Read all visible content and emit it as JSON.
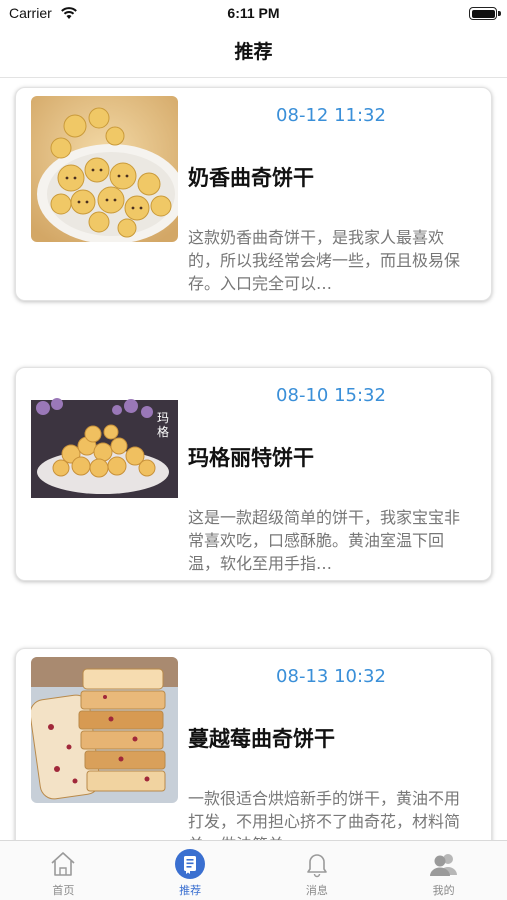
{
  "status_bar": {
    "carrier": "Carrier",
    "time": "6:11 PM"
  },
  "nav": {
    "title": "推荐"
  },
  "feed": {
    "items": [
      {
        "time": "08-12 11:32",
        "title": "奶香曲奇饼干",
        "description": "这款奶香曲奇饼干，是我家人最喜欢的，所以我经常会烤一些，而且极易保存。入口完全可以…",
        "image": "hello-kitty-cookies-photo"
      },
      {
        "time": "08-10 15:32",
        "title": "玛格丽特饼干",
        "description": "这是一款超级简单的饼干，我家宝宝非常喜欢吃，口感酥脆。黄油室温下回温，软化至用手指…",
        "image": "margherita-cookies-photo"
      },
      {
        "time": "08-13 10:32",
        "title": "蔓越莓曲奇饼干",
        "description": "一款很适合烘焙新手的饼干，黄油不用打发，不用担心挤不了曲奇花，材料简单，做法简单…",
        "image": "cranberry-cookies-photo"
      }
    ]
  },
  "tabs": [
    {
      "label": "首页",
      "icon": "home-icon",
      "active": false
    },
    {
      "label": "推荐",
      "icon": "recommend-icon",
      "active": true
    },
    {
      "label": "消息",
      "icon": "bell-icon",
      "active": false
    },
    {
      "label": "我的",
      "icon": "profile-icon",
      "active": false
    }
  ],
  "colors": {
    "accent": "#3a8fd8",
    "tab_active": "#3a6fd0"
  }
}
